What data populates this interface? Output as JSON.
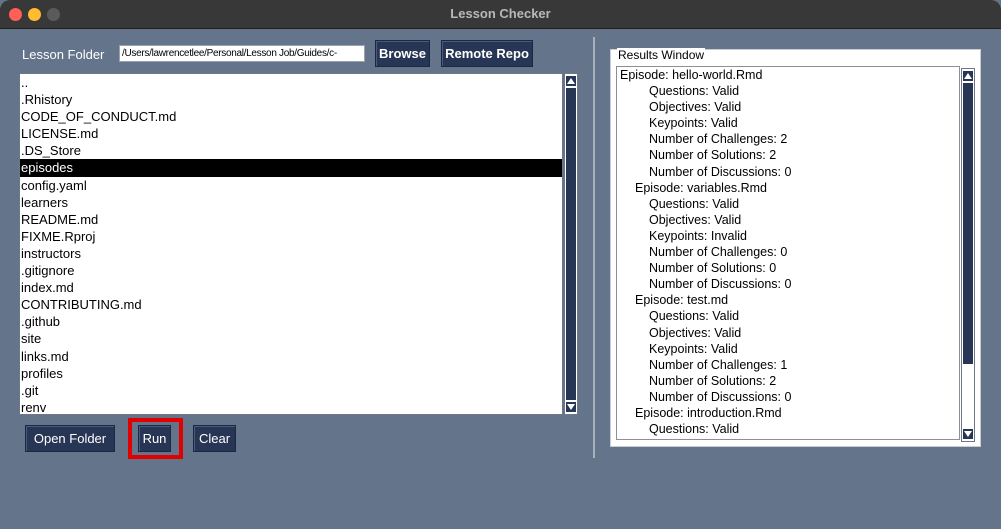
{
  "window": {
    "title": "Lesson Checker"
  },
  "lesson_folder": {
    "label": "Lesson Folder",
    "path": "/Users/lawrencetlee/Personal/Lesson Job/Guides/c-",
    "browse_label": "Browse",
    "remote_label": "Remote Repo"
  },
  "files": [
    "..",
    ".Rhistory",
    "CODE_OF_CONDUCT.md",
    "LICENSE.md",
    ".DS_Store",
    "episodes",
    "config.yaml",
    "learners",
    "README.md",
    "FIXME.Rproj",
    "instructors",
    ".gitignore",
    "index.md",
    "CONTRIBUTING.md",
    ".github",
    "site",
    "links.md",
    "profiles",
    ".git",
    "renv"
  ],
  "selected_file": "episodes",
  "actions": {
    "open_folder": "Open Folder",
    "run": "Run",
    "clear": "Clear"
  },
  "results": {
    "legend": "Results Window",
    "lines": [
      {
        "text": "Episode: hello-world.Rmd",
        "level": 0
      },
      {
        "text": "Questions: Valid",
        "level": 2
      },
      {
        "text": "Objectives: Valid",
        "level": 2
      },
      {
        "text": "Keypoints: Valid",
        "level": 2
      },
      {
        "text": "Number of Challenges: 2",
        "level": 2
      },
      {
        "text": "Number of Solutions: 2",
        "level": 2
      },
      {
        "text": "Number of Discussions: 0",
        "level": 2
      },
      {
        "text": "Episode: variables.Rmd",
        "level": 1
      },
      {
        "text": "Questions: Valid",
        "level": 2
      },
      {
        "text": "Objectives: Valid",
        "level": 2
      },
      {
        "text": "Keypoints: Invalid",
        "level": 2
      },
      {
        "text": "Number of Challenges: 0",
        "level": 2
      },
      {
        "text": "Number of Solutions: 0",
        "level": 2
      },
      {
        "text": "Number of Discussions: 0",
        "level": 2
      },
      {
        "text": "Episode: test.md",
        "level": 1
      },
      {
        "text": "Questions: Valid",
        "level": 2
      },
      {
        "text": "Objectives: Valid",
        "level": 2
      },
      {
        "text": "Keypoints: Valid",
        "level": 2
      },
      {
        "text": "Number of Challenges: 1",
        "level": 2
      },
      {
        "text": "Number of Solutions: 2",
        "level": 2
      },
      {
        "text": "Number of Discussions: 0",
        "level": 2
      },
      {
        "text": "Episode: introduction.Rmd",
        "level": 1
      },
      {
        "text": "Questions: Valid",
        "level": 2
      }
    ]
  },
  "icons": {
    "close": "close-icon",
    "minimize": "minimize-icon",
    "maximize": "maximize-icon",
    "scroll_up": "scroll-up-arrow-icon",
    "scroll_down": "scroll-down-arrow-icon"
  },
  "colors": {
    "window_bg": "#64748b",
    "button_bg": "#283655",
    "selection_bg": "#000000",
    "highlight": "#e00000"
  }
}
